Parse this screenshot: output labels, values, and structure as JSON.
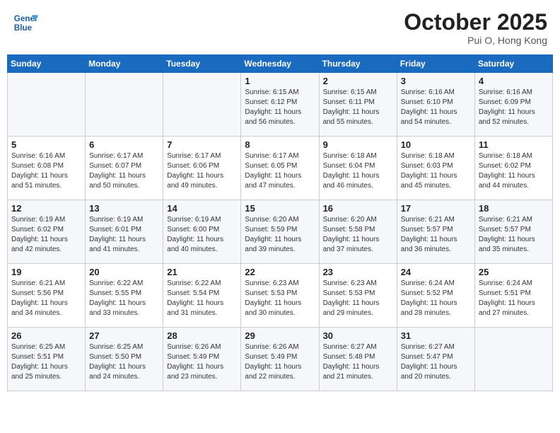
{
  "header": {
    "logo_line1": "General",
    "logo_line2": "Blue",
    "month": "October 2025",
    "location": "Pui O, Hong Kong"
  },
  "weekdays": [
    "Sunday",
    "Monday",
    "Tuesday",
    "Wednesday",
    "Thursday",
    "Friday",
    "Saturday"
  ],
  "weeks": [
    [
      {
        "day": "",
        "info": ""
      },
      {
        "day": "",
        "info": ""
      },
      {
        "day": "",
        "info": ""
      },
      {
        "day": "1",
        "info": "Sunrise: 6:15 AM\nSunset: 6:12 PM\nDaylight: 11 hours\nand 56 minutes."
      },
      {
        "day": "2",
        "info": "Sunrise: 6:15 AM\nSunset: 6:11 PM\nDaylight: 11 hours\nand 55 minutes."
      },
      {
        "day": "3",
        "info": "Sunrise: 6:16 AM\nSunset: 6:10 PM\nDaylight: 11 hours\nand 54 minutes."
      },
      {
        "day": "4",
        "info": "Sunrise: 6:16 AM\nSunset: 6:09 PM\nDaylight: 11 hours\nand 52 minutes."
      }
    ],
    [
      {
        "day": "5",
        "info": "Sunrise: 6:16 AM\nSunset: 6:08 PM\nDaylight: 11 hours\nand 51 minutes."
      },
      {
        "day": "6",
        "info": "Sunrise: 6:17 AM\nSunset: 6:07 PM\nDaylight: 11 hours\nand 50 minutes."
      },
      {
        "day": "7",
        "info": "Sunrise: 6:17 AM\nSunset: 6:06 PM\nDaylight: 11 hours\nand 49 minutes."
      },
      {
        "day": "8",
        "info": "Sunrise: 6:17 AM\nSunset: 6:05 PM\nDaylight: 11 hours\nand 47 minutes."
      },
      {
        "day": "9",
        "info": "Sunrise: 6:18 AM\nSunset: 6:04 PM\nDaylight: 11 hours\nand 46 minutes."
      },
      {
        "day": "10",
        "info": "Sunrise: 6:18 AM\nSunset: 6:03 PM\nDaylight: 11 hours\nand 45 minutes."
      },
      {
        "day": "11",
        "info": "Sunrise: 6:18 AM\nSunset: 6:02 PM\nDaylight: 11 hours\nand 44 minutes."
      }
    ],
    [
      {
        "day": "12",
        "info": "Sunrise: 6:19 AM\nSunset: 6:02 PM\nDaylight: 11 hours\nand 42 minutes."
      },
      {
        "day": "13",
        "info": "Sunrise: 6:19 AM\nSunset: 6:01 PM\nDaylight: 11 hours\nand 41 minutes."
      },
      {
        "day": "14",
        "info": "Sunrise: 6:19 AM\nSunset: 6:00 PM\nDaylight: 11 hours\nand 40 minutes."
      },
      {
        "day": "15",
        "info": "Sunrise: 6:20 AM\nSunset: 5:59 PM\nDaylight: 11 hours\nand 39 minutes."
      },
      {
        "day": "16",
        "info": "Sunrise: 6:20 AM\nSunset: 5:58 PM\nDaylight: 11 hours\nand 37 minutes."
      },
      {
        "day": "17",
        "info": "Sunrise: 6:21 AM\nSunset: 5:57 PM\nDaylight: 11 hours\nand 36 minutes."
      },
      {
        "day": "18",
        "info": "Sunrise: 6:21 AM\nSunset: 5:57 PM\nDaylight: 11 hours\nand 35 minutes."
      }
    ],
    [
      {
        "day": "19",
        "info": "Sunrise: 6:21 AM\nSunset: 5:56 PM\nDaylight: 11 hours\nand 34 minutes."
      },
      {
        "day": "20",
        "info": "Sunrise: 6:22 AM\nSunset: 5:55 PM\nDaylight: 11 hours\nand 33 minutes."
      },
      {
        "day": "21",
        "info": "Sunrise: 6:22 AM\nSunset: 5:54 PM\nDaylight: 11 hours\nand 31 minutes."
      },
      {
        "day": "22",
        "info": "Sunrise: 6:23 AM\nSunset: 5:53 PM\nDaylight: 11 hours\nand 30 minutes."
      },
      {
        "day": "23",
        "info": "Sunrise: 6:23 AM\nSunset: 5:53 PM\nDaylight: 11 hours\nand 29 minutes."
      },
      {
        "day": "24",
        "info": "Sunrise: 6:24 AM\nSunset: 5:52 PM\nDaylight: 11 hours\nand 28 minutes."
      },
      {
        "day": "25",
        "info": "Sunrise: 6:24 AM\nSunset: 5:51 PM\nDaylight: 11 hours\nand 27 minutes."
      }
    ],
    [
      {
        "day": "26",
        "info": "Sunrise: 6:25 AM\nSunset: 5:51 PM\nDaylight: 11 hours\nand 25 minutes."
      },
      {
        "day": "27",
        "info": "Sunrise: 6:25 AM\nSunset: 5:50 PM\nDaylight: 11 hours\nand 24 minutes."
      },
      {
        "day": "28",
        "info": "Sunrise: 6:26 AM\nSunset: 5:49 PM\nDaylight: 11 hours\nand 23 minutes."
      },
      {
        "day": "29",
        "info": "Sunrise: 6:26 AM\nSunset: 5:49 PM\nDaylight: 11 hours\nand 22 minutes."
      },
      {
        "day": "30",
        "info": "Sunrise: 6:27 AM\nSunset: 5:48 PM\nDaylight: 11 hours\nand 21 minutes."
      },
      {
        "day": "31",
        "info": "Sunrise: 6:27 AM\nSunset: 5:47 PM\nDaylight: 11 hours\nand 20 minutes."
      },
      {
        "day": "",
        "info": ""
      }
    ]
  ]
}
